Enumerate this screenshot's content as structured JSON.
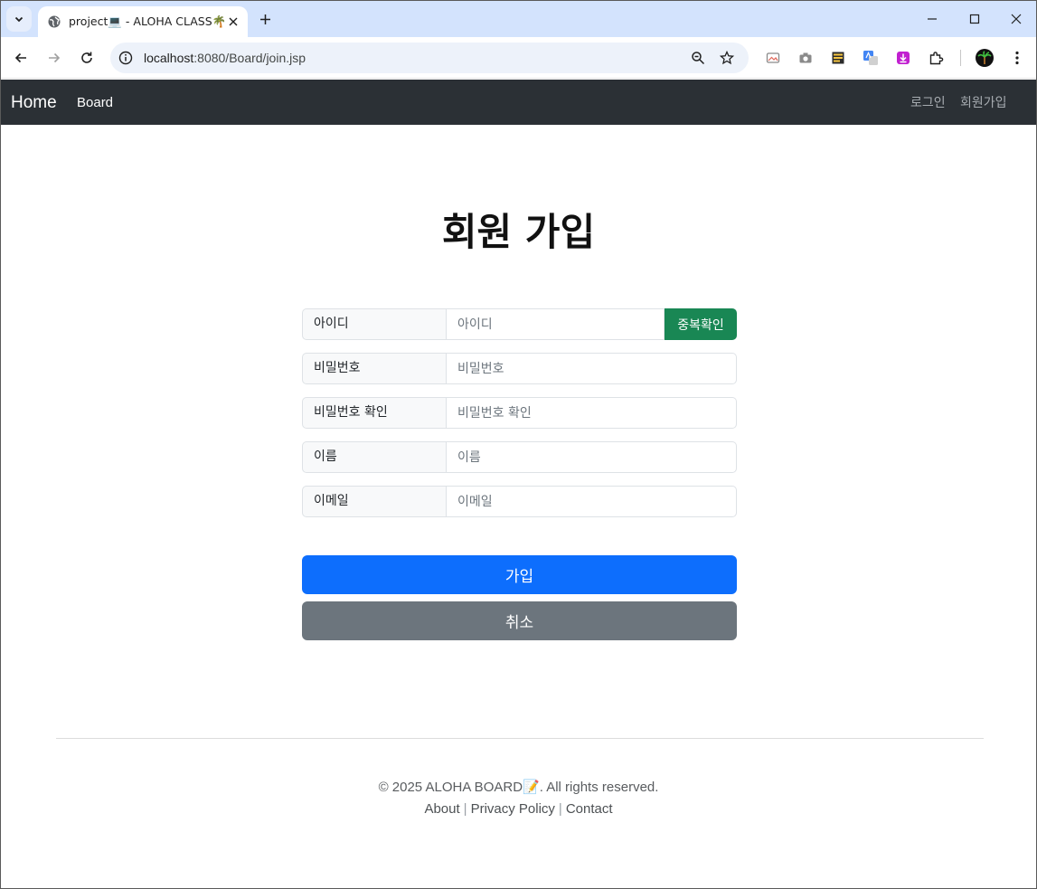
{
  "browser": {
    "tab_title": "project💻 - ALOHA CLASS🌴",
    "url_host": "localhost",
    "url_path": ":8080/Board/join.jsp"
  },
  "navbar": {
    "brand": "Home",
    "board": "Board",
    "login": "로그인",
    "signup": "회원가입"
  },
  "page": {
    "title": "회원 가입"
  },
  "form": {
    "id_label": "아이디",
    "id_placeholder": "아이디",
    "dup_check": "중복확인",
    "pw_label": "비밀번호",
    "pw_placeholder": "비밀번호",
    "pw_confirm_label": "비밀번호 확인",
    "pw_confirm_placeholder": "비밀번호 확인",
    "name_label": "이름",
    "name_placeholder": "이름",
    "email_label": "이메일",
    "email_placeholder": "이메일",
    "submit": "가입",
    "cancel": "취소"
  },
  "footer": {
    "copyright": "© 2025 ALOHA BOARD📝. All rights reserved.",
    "about": "About",
    "privacy": "Privacy Policy",
    "contact": "Contact",
    "separator": "|"
  },
  "colors": {
    "navbar_bg": "#2b3035",
    "primary": "#0d6efd",
    "success": "#198754",
    "secondary": "#6c757d",
    "tabstrip": "#d3e3fd"
  }
}
